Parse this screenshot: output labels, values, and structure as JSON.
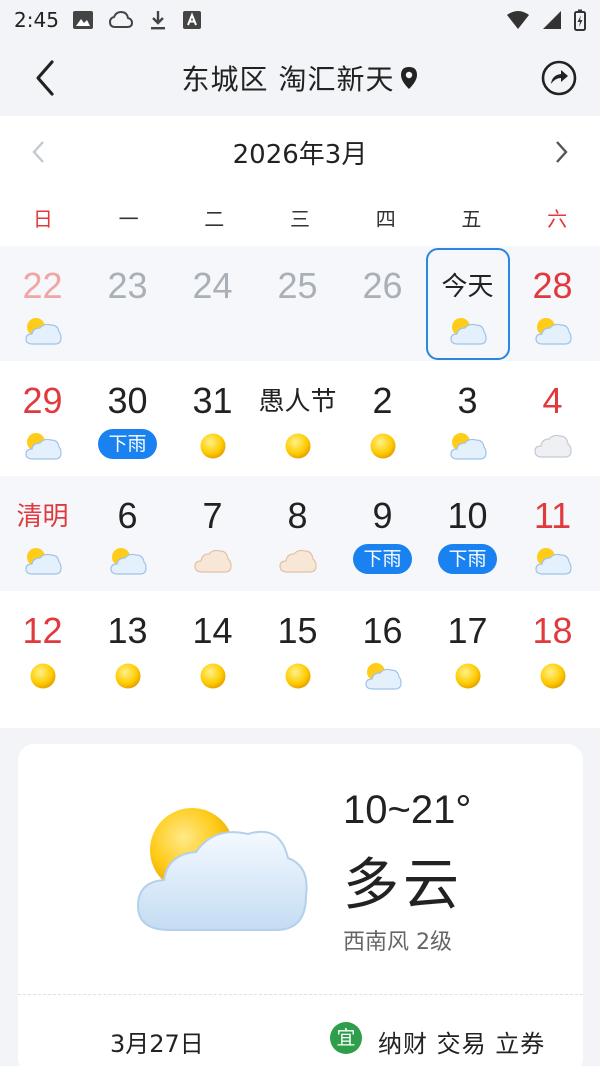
{
  "status_bar": {
    "time": "2:45"
  },
  "header": {
    "title": "东城区 淘汇新天"
  },
  "calendar": {
    "month_title": "2026年3月",
    "weekdays": [
      "日",
      "一",
      "二",
      "三",
      "四",
      "五",
      "六"
    ],
    "weeks": [
      [
        {
          "label": "22",
          "style": "lightred",
          "weather": "partly-cloudy-icon"
        },
        {
          "label": "23",
          "style": "gray",
          "weather": ""
        },
        {
          "label": "24",
          "style": "gray",
          "weather": ""
        },
        {
          "label": "25",
          "style": "gray",
          "weather": ""
        },
        {
          "label": "26",
          "style": "gray",
          "weather": ""
        },
        {
          "label": "今天",
          "style": "today",
          "weather": "partly-cloudy-icon"
        },
        {
          "label": "28",
          "style": "red",
          "weather": "partly-cloudy-icon"
        }
      ],
      [
        {
          "label": "29",
          "style": "red",
          "weather": "partly-cloudy-icon"
        },
        {
          "label": "30",
          "style": "normal",
          "weather": "rain",
          "badge": "下雨"
        },
        {
          "label": "31",
          "style": "normal",
          "weather": "sun-icon"
        },
        {
          "label": "愚人节",
          "style": "text",
          "weather": "sun-icon"
        },
        {
          "label": "2",
          "style": "normal",
          "weather": "sun-icon"
        },
        {
          "label": "3",
          "style": "normal",
          "weather": "partly-cloudy-icon"
        },
        {
          "label": "4",
          "style": "red",
          "weather": "cloud-icon"
        }
      ],
      [
        {
          "label": "清明",
          "style": "redtext",
          "weather": "partly-cloudy-icon"
        },
        {
          "label": "6",
          "style": "normal",
          "weather": "partly-cloudy-icon"
        },
        {
          "label": "7",
          "style": "normal",
          "weather": "haze-cloud-icon"
        },
        {
          "label": "8",
          "style": "normal",
          "weather": "haze-cloud-icon"
        },
        {
          "label": "9",
          "style": "normal",
          "weather": "rain",
          "badge": "下雨"
        },
        {
          "label": "10",
          "style": "normal",
          "weather": "rain",
          "badge": "下雨"
        },
        {
          "label": "11",
          "style": "red",
          "weather": "partly-cloudy-icon"
        }
      ],
      [
        {
          "label": "12",
          "style": "red",
          "weather": "sun-icon"
        },
        {
          "label": "13",
          "style": "normal",
          "weather": "sun-icon"
        },
        {
          "label": "14",
          "style": "normal",
          "weather": "sun-icon"
        },
        {
          "label": "15",
          "style": "normal",
          "weather": "sun-icon"
        },
        {
          "label": "16",
          "style": "normal",
          "weather": "partly-cloudy-icon"
        },
        {
          "label": "17",
          "style": "normal",
          "weather": "sun-icon"
        },
        {
          "label": "18",
          "style": "red",
          "weather": "sun-icon"
        }
      ]
    ]
  },
  "forecast": {
    "temperature": "10~21°",
    "condition": "多云",
    "wind": "西南风 2级",
    "date": "3月27日",
    "yi_badge": "宜",
    "yi_items": "纳财 交易 立券"
  },
  "colors": {
    "accent_blue": "#1a82f0",
    "holiday_red": "#e0393e",
    "yi_green": "#2f9e4a"
  }
}
